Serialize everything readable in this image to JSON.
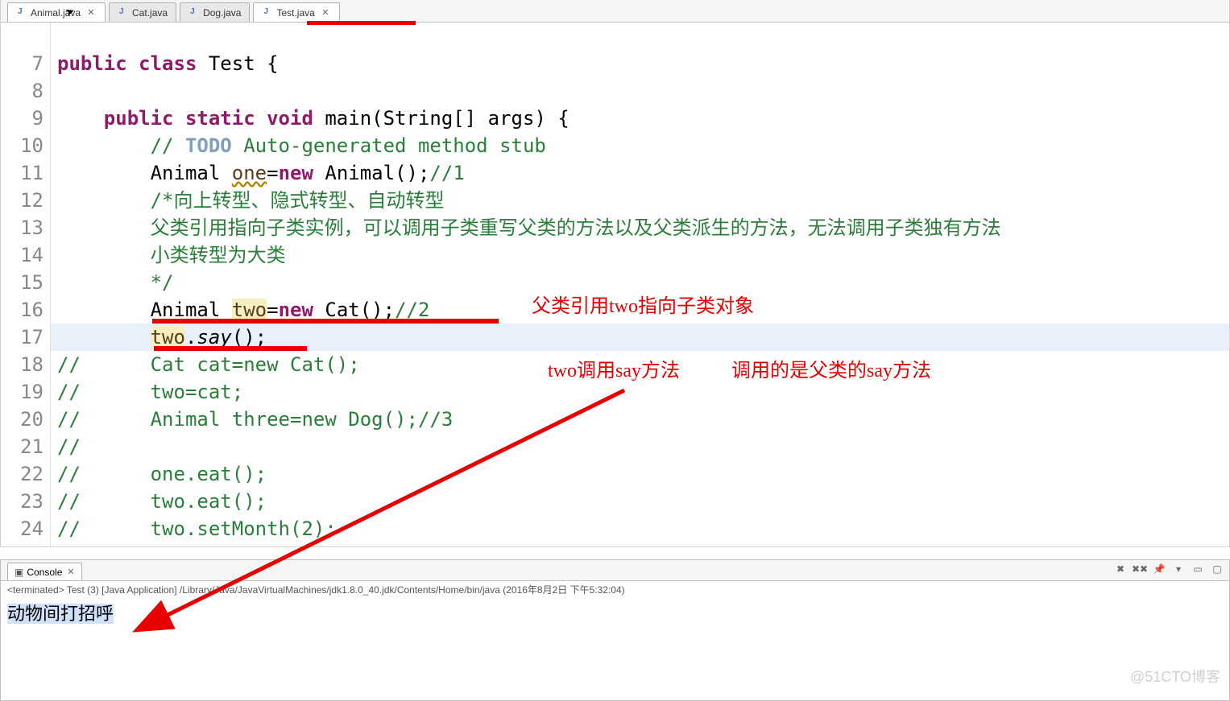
{
  "tabs": [
    {
      "label": "Animal.java",
      "active": true,
      "closable": true
    },
    {
      "label": "Cat.java",
      "active": false,
      "closable": false
    },
    {
      "label": "Dog.java",
      "active": false,
      "closable": false
    },
    {
      "label": "Test.java",
      "active": true,
      "closable": true
    }
  ],
  "lineNumbers": [
    "",
    "7",
    "8",
    "9",
    "10",
    "11",
    "12",
    "13",
    "14",
    "15",
    "16",
    "17",
    "18",
    "19",
    "20",
    "21",
    "22",
    "23",
    "24"
  ],
  "code": {
    "l7_public": "public",
    "l7_class": "class",
    "l7_name": "Test",
    "l7_brace": " {",
    "l9_public": "public",
    "l9_static": "static",
    "l9_void": "void",
    "l9_sig": " main(String[] args) {",
    "l10_pre": "// ",
    "l10_todo": "TODO",
    "l10_rest": " Auto-generated method stub",
    "l11_a": "Animal ",
    "l11_one": "one",
    "l11_eq": "=",
    "l11_new": "new",
    "l11_b": " Animal();",
    "l11_c": "//1",
    "l12": "/*向上转型、隐式转型、自动转型",
    "l13": "父类引用指向子类实例，可以调用子类重写父类的方法以及父类派生的方法，无法调用子类独有方法",
    "l14": "小类转型为大类",
    "l15": "*/",
    "l16_a": "Animal ",
    "l16_two": "two",
    "l16_eq": "=",
    "l16_new": "new",
    "l16_b": " Cat();",
    "l16_c": "//2",
    "l17_two": "two",
    "l17_call": ".say();",
    "l17_say": "say",
    "l17_pre": ".",
    "l17_post": "();",
    "l18_sl": "//",
    "l18": "Cat cat=new Cat();",
    "l19_sl": "//",
    "l19": "two=cat;",
    "l20_sl": "//",
    "l20": "Animal three=new Dog();//3",
    "l21_sl": "//",
    "l22_sl": "//",
    "l22": "one.eat();",
    "l23_sl": "//",
    "l23": "two.eat();",
    "l24_sl": "//",
    "l24": "two.setMonth(2);"
  },
  "annotations": {
    "a1": "父类引用two指向子类对象",
    "a2": "two调用say方法",
    "a3": "调用的是父类的say方法"
  },
  "console": {
    "tab": "Console",
    "status": "<terminated> Test (3) [Java Application] /Library/Java/JavaVirtualMachines/jdk1.8.0_40.jdk/Contents/Home/bin/java (2016年8月2日 下午5:32:04)",
    "output": "动物间打招呼"
  },
  "watermark": "@51CTO博客"
}
